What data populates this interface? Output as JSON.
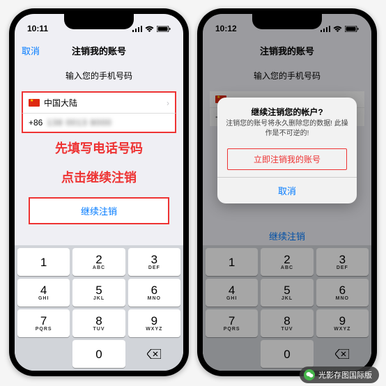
{
  "status": {
    "time1": "10:11",
    "time2": "10:12"
  },
  "nav": {
    "cancel": "取消",
    "title": "注销我的账号"
  },
  "subtitle": "输入您的手机号码",
  "country": {
    "name": "中国大陆",
    "code": "+86",
    "phone": "138 0013 8000"
  },
  "instructions": {
    "line1": "先填写电话号码",
    "line2": "点击继续注销"
  },
  "continue_label": "继续注销",
  "alert": {
    "title": "继续注销您的帐户?",
    "message": "注销您的账号将永久删除您的数据! 此操作是不可逆的!",
    "confirm": "立即注销我的账号",
    "cancel": "取消"
  },
  "keypad": {
    "keys": [
      {
        "n": "1",
        "l": ""
      },
      {
        "n": "2",
        "l": "ABC"
      },
      {
        "n": "3",
        "l": "DEF"
      },
      {
        "n": "4",
        "l": "GHI"
      },
      {
        "n": "5",
        "l": "JKL"
      },
      {
        "n": "6",
        "l": "MNO"
      },
      {
        "n": "7",
        "l": "PQRS"
      },
      {
        "n": "8",
        "l": "TUV"
      },
      {
        "n": "9",
        "l": "WXYZ"
      },
      {
        "n": "",
        "l": ""
      },
      {
        "n": "0",
        "l": ""
      },
      {
        "n": "⌫",
        "l": ""
      }
    ]
  },
  "watermark": "光影存图国际版"
}
